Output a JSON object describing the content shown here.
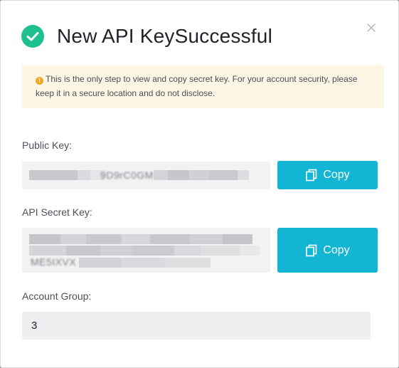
{
  "dialog": {
    "title": "New API KeySuccessful",
    "notice": "This is the only step to view and copy secret key. For your account security, please keep it in a secure location and do not disclose.",
    "warning_glyph": "!",
    "colors": {
      "success": "#1fbf8f",
      "accent": "#13b5d4",
      "notice_bg": "#fdf6e4",
      "warning": "#f5a623"
    }
  },
  "public_key": {
    "label": "Public Key:",
    "visible_fragment": "9D9rC0GM",
    "copy_label": "Copy"
  },
  "secret_key": {
    "label": "API Secret Key:",
    "visible_fragment": "ME5IXVX",
    "copy_label": "Copy"
  },
  "account_group": {
    "label": "Account Group:",
    "value": "3"
  },
  "icons": {
    "success": "check-circle-icon",
    "close": "close-icon",
    "copy": "copy-icon",
    "warning": "warning-icon"
  }
}
